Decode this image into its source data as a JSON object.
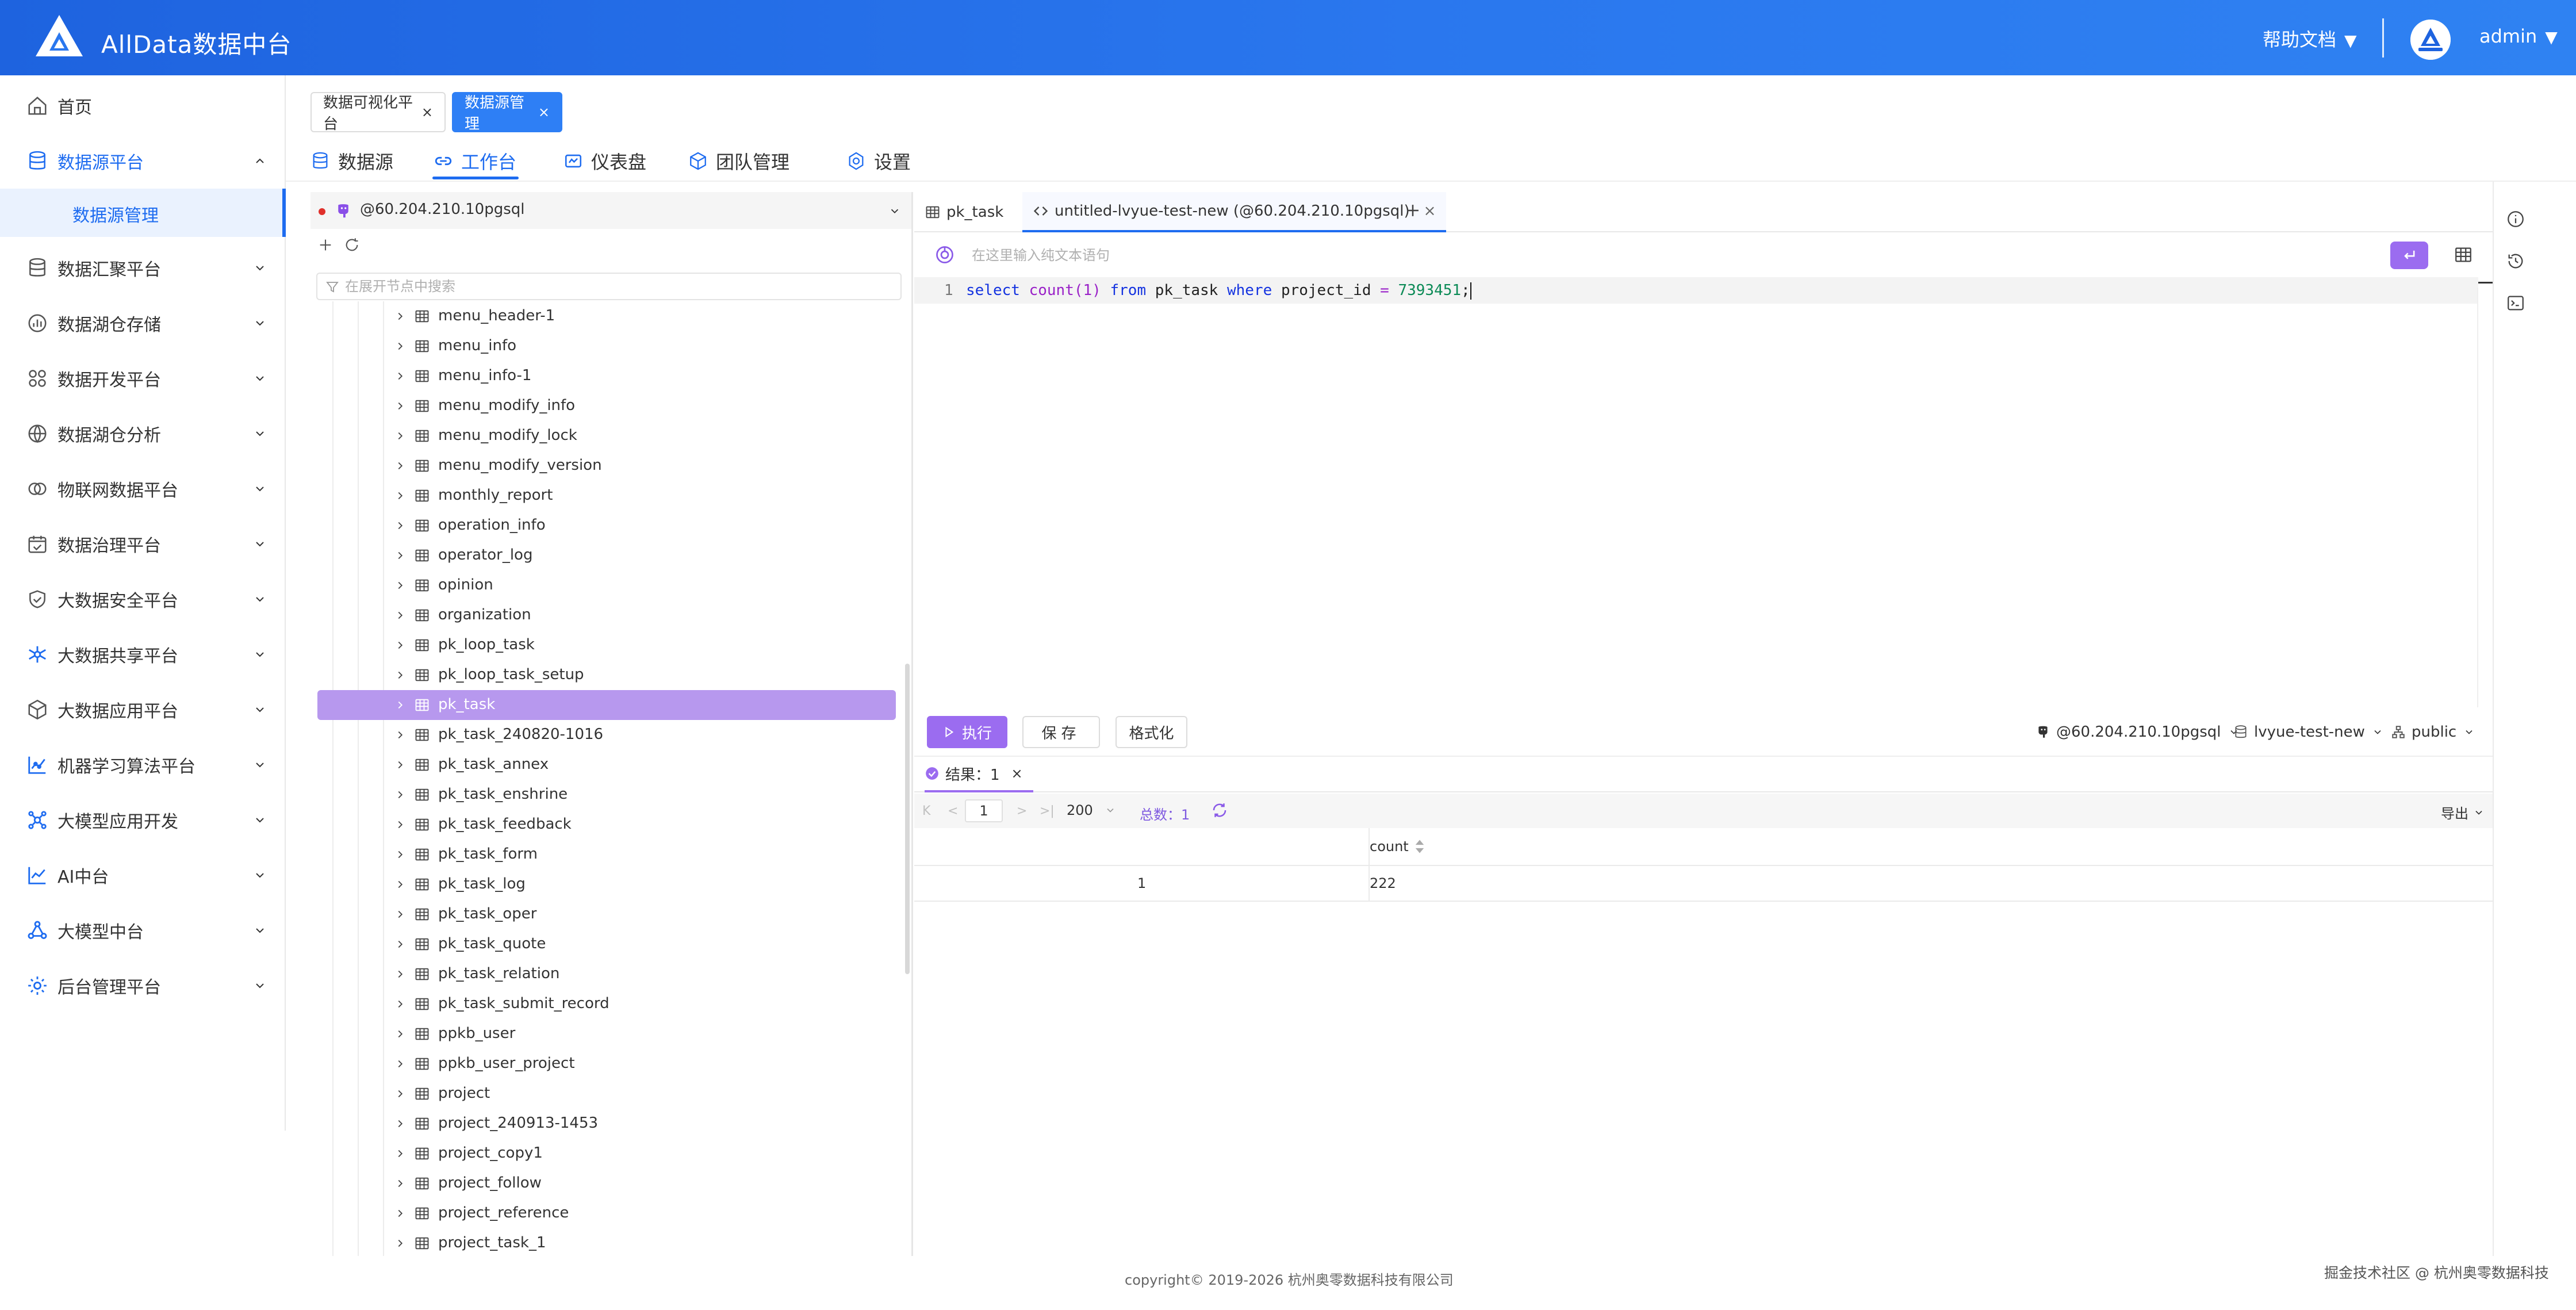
{
  "app": {
    "brand": "AllData数据中台"
  },
  "header": {
    "help": "帮助文档",
    "user": "admin",
    "caret": "▼"
  },
  "sidebar": {
    "items": [
      {
        "label": "首页",
        "icon": "home-icon"
      },
      {
        "label": "数据源平台",
        "icon": "database-icon",
        "expanded": true
      },
      {
        "label": "数据汇聚平台",
        "icon": "database-stack-icon"
      },
      {
        "label": "数据湖仓存储",
        "icon": "chart-circle-icon"
      },
      {
        "label": "数据开发平台",
        "icon": "grid-icon"
      },
      {
        "label": "数据湖仓分析",
        "icon": "globe-icon"
      },
      {
        "label": "物联网数据平台",
        "icon": "iot-icon"
      },
      {
        "label": "数据治理平台",
        "icon": "calendar-check-icon"
      },
      {
        "label": "大数据安全平台",
        "icon": "shield-icon"
      },
      {
        "label": "大数据共享平台",
        "icon": "share-hub-icon"
      },
      {
        "label": "大数据应用平台",
        "icon": "cube-icon"
      },
      {
        "label": "机器学习算法平台",
        "icon": "ml-chart-icon"
      },
      {
        "label": "大模型应用开发",
        "icon": "network-icon"
      },
      {
        "label": "AI中台",
        "icon": "ai-chart-icon"
      },
      {
        "label": "大模型中台",
        "icon": "molecule-icon"
      },
      {
        "label": "后台管理平台",
        "icon": "settings-gear-icon"
      }
    ],
    "sub_item": "数据源管理"
  },
  "tags": [
    {
      "label": "数据可视化平台",
      "close": "×"
    },
    {
      "label": "数据源管理",
      "close": "×"
    }
  ],
  "nav_tabs": [
    {
      "label": "数据源",
      "icon": "database-icon"
    },
    {
      "label": "工作台",
      "icon": "link-icon"
    },
    {
      "label": "仪表盘",
      "icon": "dashboard-icon"
    },
    {
      "label": "团队管理",
      "icon": "cube-icon"
    },
    {
      "label": "设置",
      "icon": "settings-icon"
    }
  ],
  "tree": {
    "connection": "@60.204.210.10pgsql",
    "search_placeholder": "在展开节点中搜索",
    "items": [
      "menu_header-1",
      "menu_info",
      "menu_info-1",
      "menu_modify_info",
      "menu_modify_lock",
      "menu_modify_version",
      "monthly_report",
      "operation_info",
      "operator_log",
      "opinion",
      "organization",
      "pk_loop_task",
      "pk_loop_task_setup",
      "pk_task",
      "pk_task_240820-1016",
      "pk_task_annex",
      "pk_task_enshrine",
      "pk_task_feedback",
      "pk_task_form",
      "pk_task_log",
      "pk_task_oper",
      "pk_task_quote",
      "pk_task_relation",
      "pk_task_submit_record",
      "ppkb_user",
      "ppkb_user_project",
      "project",
      "project_240913-1453",
      "project_copy1",
      "project_follow",
      "project_reference",
      "project_task_1"
    ],
    "selected_index": 13
  },
  "editor": {
    "tabs": [
      {
        "label": "pk_task",
        "icon": "table-icon"
      },
      {
        "label": "untitled-lvyue-test-new (@60.204.210.10pgsql)",
        "icon": "code-icon",
        "close": "×"
      }
    ],
    "add_tab": "+",
    "prompt_placeholder": "在这里输入纯文本语句",
    "line_number": "1",
    "code": {
      "select": "select",
      "count": "count",
      "arg": "(1)",
      "from": "from",
      "table": "pk_task",
      "where": "where",
      "column": "project_id",
      "eq": "=",
      "value": "7393451",
      "end": ";"
    }
  },
  "actions": {
    "run": "执行",
    "save": "保存",
    "format": "格式化",
    "connection": "@60.204.210.10pgsql",
    "database": "lvyue-test-new",
    "schema": "public"
  },
  "results": {
    "tab_label": "结果：1",
    "close": "×",
    "page": "1",
    "page_size": "200",
    "total": "总数：1",
    "export": "导出",
    "nav": {
      "first": "K",
      "prev": "<",
      "next": ">",
      "last": ">|"
    },
    "columns": [
      "count"
    ],
    "rows": [
      {
        "index": "1",
        "count": "222"
      }
    ]
  },
  "footer": {
    "copyright": "copyright© 2019-2026 杭州奥零数据科技有限公司",
    "watermark": "掘金技术社区 @ 杭州奥零数据科技"
  },
  "colors": {
    "header": "#2a77ee",
    "accent": "#1e6cf0",
    "purple": "#9b6cf0",
    "selected_row": "#b798ee"
  }
}
